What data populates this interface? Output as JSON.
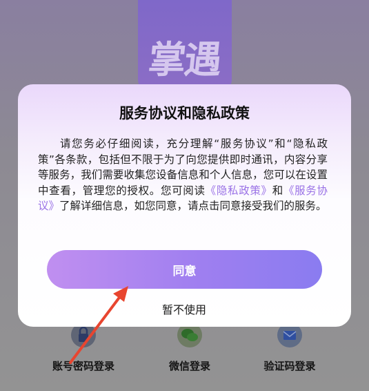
{
  "app": {
    "logo_text": "掌遇"
  },
  "login_options": [
    {
      "label": "账号密码登录",
      "icon": "lock-icon"
    },
    {
      "label": "微信登录",
      "icon": "wechat-icon"
    },
    {
      "label": "验证码登录",
      "icon": "mail-icon"
    }
  ],
  "dialog": {
    "title": "服务协议和隐私政策",
    "body_part1": "请您务必仔细阅读，充分理解“服务协议”和“隐私政策”各条款，包括但不限于为了向您提供即时通讯，内容分享等服务，我们需要收集您设备信息和个人信息，您可以在设置中查看，管理您的授权。您可阅读",
    "privacy_link": "《隐私政策》",
    "body_and": "和",
    "service_link": "《服务协议》",
    "body_part2": "了解详细信息，如您同意，请点击同意接受我们的服务。",
    "agree_label": "同意",
    "decline_label": "暂不使用"
  },
  "colors": {
    "accent_purple": "#9a72e6",
    "annotation_red": "#e8452f"
  }
}
